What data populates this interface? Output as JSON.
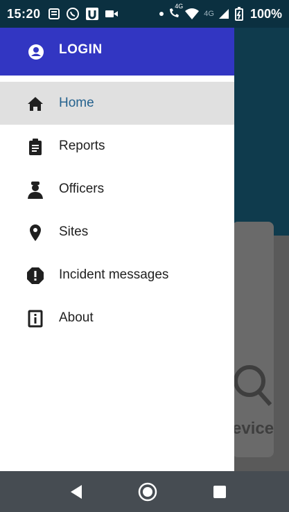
{
  "status_bar": {
    "time": "15:20",
    "battery": "100%",
    "net_a": "4G",
    "net_b": "4G",
    "icons_left": [
      "news-icon",
      "whatsapp-icon",
      "u-app-icon",
      "video-icon"
    ],
    "icons_right": [
      "dot-icon",
      "wifi-call-icon",
      "wifi-icon",
      "signal-icon",
      "battery-charging-icon"
    ]
  },
  "drawer": {
    "login_label": "LOGIN",
    "items": [
      {
        "label": "Home",
        "icon": "home-icon",
        "active": true
      },
      {
        "label": "Reports",
        "icon": "clipboard-icon",
        "active": false
      },
      {
        "label": "Officers",
        "icon": "officer-icon",
        "active": false
      },
      {
        "label": "Sites",
        "icon": "location-pin-icon",
        "active": false
      },
      {
        "label": "Incident messages",
        "icon": "alert-octagon-icon",
        "active": false
      },
      {
        "label": "About",
        "icon": "info-icon",
        "active": false
      }
    ]
  },
  "background": {
    "card_text": "evice"
  },
  "colors": {
    "drawer_header": "#3236c2",
    "active_item_bg": "#e0e0e0",
    "active_item_text": "#25628e",
    "status_bar": "#0b3040",
    "nav_bar": "#464c52"
  },
  "nav_bar": {
    "buttons": [
      "back-icon",
      "home-circle-icon",
      "recents-icon"
    ]
  }
}
